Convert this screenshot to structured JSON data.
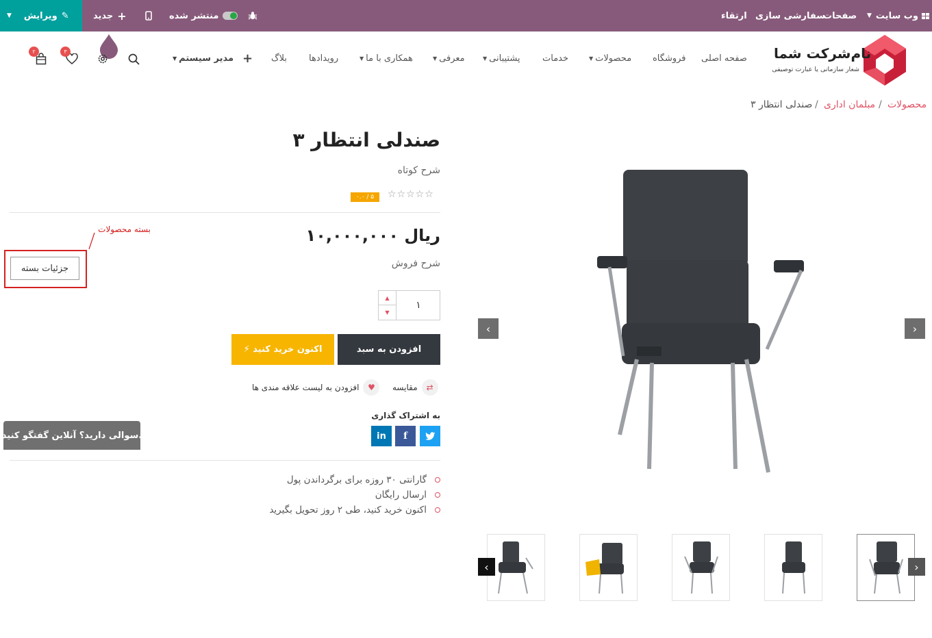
{
  "adminbar": {
    "edit": "ویرایش",
    "new": "جدید",
    "published": "منتشر شده",
    "website_menu": "وب سایت",
    "pages": "صفحات",
    "customize": "سفارشی سازی",
    "upgrade": "ارتقاء"
  },
  "header": {
    "logo_title": "نام‌شرکت شما",
    "logo_tagline": "شعار سازمانی یا عبارت توصیفی",
    "nav": {
      "home": "صفحه اصلی",
      "shop": "فروشگاه",
      "products": "محصولات",
      "services": "خدمات",
      "support": "پشتیبانی",
      "intro": "معرفی",
      "cooperate": "همکاری با ما",
      "events": "رویدادها",
      "blog": "بلاگ",
      "admin": "مدیر سیستم"
    },
    "wishlist_count": "۳",
    "cart_count": "۲",
    "colors": {
      "admin_bar": "#875a7b",
      "edit_button": "#00a09d",
      "accent": "#e05264"
    }
  },
  "breadcrumb": {
    "root": "محصولات",
    "category": "مبلمان اداری",
    "current": "صندلی انتظار ۳",
    "separator": "/"
  },
  "product": {
    "title": "صندلی انتظار ۳",
    "short_description": "شرح کوتاه",
    "stars": "☆☆☆☆☆",
    "rating_text": "۰.۰ / ۵",
    "price": "۱۰,۰۰۰,۰۰۰ ریال",
    "sale_description": "شرح فروش",
    "quantity": "۱",
    "add_to_cart": "افزودن به سبد",
    "buy_now": "⚡ اکنون خرید کنید",
    "compare": "مقایسه",
    "add_to_wishlist": "افزودن به لیست علاقه مندی ها",
    "share_label": "به اشتراک گذاری",
    "social": [
      "twitter",
      "facebook",
      "linkedin"
    ],
    "guarantees": [
      "گارانتی ۳۰ روزه برای برگرداندن پول",
      "ارسال رایگان",
      "اکنون خرید کنید، طی ۲ روز تحویل بگیرید"
    ]
  },
  "bundle": {
    "note": "بسته محصولات",
    "details_button": "جزئیات بسته"
  },
  "chat_button": "سوالی دارید؟ آنلاین گفتگو کنید.",
  "gallery": {
    "thumb_count": 5,
    "active_index": 0
  }
}
